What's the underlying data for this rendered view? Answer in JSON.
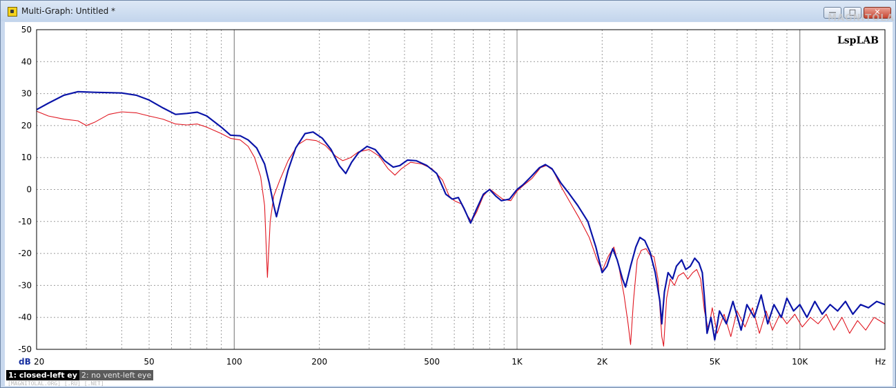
{
  "window": {
    "title": "Multi-Graph: Untitled *",
    "minimize_glyph": "—",
    "maximize_glyph": "□",
    "close_glyph": "✕",
    "watermark": "MAGNITOLA"
  },
  "legend": {
    "items": [
      {
        "label": "1: closed-left ey",
        "active": true
      },
      {
        "label": "2: no vent-left eye",
        "active": false
      }
    ]
  },
  "status_hint": "[MAGNITOLAL.ORG] [.RU] [.NET]",
  "chart_data": {
    "type": "line",
    "brand": "LspLAB",
    "ylabel": "dB",
    "xunit": "Hz",
    "xscale": "log",
    "xlim": [
      20,
      20000
    ],
    "ylim": [
      -50,
      50
    ],
    "grid": true,
    "x_ticks": [
      {
        "v": 20,
        "label": "20"
      },
      {
        "v": 50,
        "label": "50"
      },
      {
        "v": 100,
        "label": "100"
      },
      {
        "v": 200,
        "label": "200"
      },
      {
        "v": 500,
        "label": "500"
      },
      {
        "v": 1000,
        "label": "1K"
      },
      {
        "v": 2000,
        "label": "2K"
      },
      {
        "v": 5000,
        "label": "5K"
      },
      {
        "v": 10000,
        "label": "10K"
      }
    ],
    "y_ticks": [
      50,
      40,
      30,
      20,
      10,
      0,
      -10,
      -20,
      -30,
      -40,
      -50
    ],
    "colors": {
      "series1": "#0a14a8",
      "series2": "#e0141e"
    },
    "series": [
      {
        "name": "closed-left ey",
        "color": "#0a14a8",
        "points": [
          [
            20,
            25
          ],
          [
            22,
            27
          ],
          [
            25,
            29.5
          ],
          [
            28,
            30.6
          ],
          [
            32,
            30.4
          ],
          [
            36,
            30.3
          ],
          [
            40,
            30.2
          ],
          [
            45,
            29.5
          ],
          [
            50,
            28
          ],
          [
            56,
            25.5
          ],
          [
            62,
            23.5
          ],
          [
            68,
            23.8
          ],
          [
            74,
            24.2
          ],
          [
            80,
            23
          ],
          [
            90,
            19.5
          ],
          [
            97,
            17
          ],
          [
            105,
            16.8
          ],
          [
            112,
            15.5
          ],
          [
            120,
            13
          ],
          [
            128,
            8
          ],
          [
            133,
            2
          ],
          [
            138,
            -5
          ],
          [
            141,
            -8.5
          ],
          [
            146,
            -3
          ],
          [
            155,
            6
          ],
          [
            165,
            13
          ],
          [
            178,
            17.5
          ],
          [
            190,
            18
          ],
          [
            205,
            16
          ],
          [
            220,
            12.5
          ],
          [
            235,
            7.5
          ],
          [
            248,
            5
          ],
          [
            260,
            8.5
          ],
          [
            275,
            11.5
          ],
          [
            295,
            13.5
          ],
          [
            315,
            12.5
          ],
          [
            340,
            9
          ],
          [
            365,
            7
          ],
          [
            385,
            7.5
          ],
          [
            410,
            9.2
          ],
          [
            440,
            9
          ],
          [
            480,
            7.5
          ],
          [
            520,
            5
          ],
          [
            560,
            -1.5
          ],
          [
            590,
            -3
          ],
          [
            620,
            -2.5
          ],
          [
            650,
            -6
          ],
          [
            685,
            -10.5
          ],
          [
            720,
            -6
          ],
          [
            760,
            -1.5
          ],
          [
            800,
            0
          ],
          [
            840,
            -2
          ],
          [
            880,
            -3.5
          ],
          [
            940,
            -3
          ],
          [
            1000,
            0
          ],
          [
            1050,
            1.5
          ],
          [
            1120,
            4
          ],
          [
            1200,
            6.8
          ],
          [
            1260,
            7.8
          ],
          [
            1330,
            6.5
          ],
          [
            1430,
            2
          ],
          [
            1520,
            -1
          ],
          [
            1640,
            -5
          ],
          [
            1780,
            -10
          ],
          [
            1900,
            -18
          ],
          [
            2000,
            -26
          ],
          [
            2080,
            -24
          ],
          [
            2180,
            -18.5
          ],
          [
            2260,
            -22
          ],
          [
            2360,
            -28
          ],
          [
            2420,
            -30.5
          ],
          [
            2520,
            -24
          ],
          [
            2630,
            -18
          ],
          [
            2720,
            -15
          ],
          [
            2830,
            -16
          ],
          [
            2950,
            -19.5
          ],
          [
            3080,
            -26
          ],
          [
            3200,
            -35
          ],
          [
            3250,
            -42
          ],
          [
            3320,
            -32
          ],
          [
            3420,
            -26
          ],
          [
            3550,
            -28
          ],
          [
            3660,
            -24
          ],
          [
            3820,
            -22
          ],
          [
            3950,
            -25
          ],
          [
            4100,
            -24
          ],
          [
            4250,
            -21.5
          ],
          [
            4400,
            -23
          ],
          [
            4520,
            -26
          ],
          [
            4600,
            -34
          ],
          [
            4700,
            -45
          ],
          [
            4850,
            -40
          ],
          [
            5000,
            -47
          ],
          [
            5200,
            -38
          ],
          [
            5500,
            -42
          ],
          [
            5800,
            -35
          ],
          [
            6200,
            -44
          ],
          [
            6500,
            -36
          ],
          [
            6900,
            -40
          ],
          [
            7300,
            -33
          ],
          [
            7700,
            -42
          ],
          [
            8100,
            -36
          ],
          [
            8600,
            -40
          ],
          [
            9000,
            -34
          ],
          [
            9500,
            -38
          ],
          [
            10000,
            -36
          ],
          [
            10600,
            -40
          ],
          [
            11300,
            -35
          ],
          [
            12000,
            -39
          ],
          [
            12800,
            -36
          ],
          [
            13600,
            -38
          ],
          [
            14500,
            -35
          ],
          [
            15400,
            -39
          ],
          [
            16400,
            -36
          ],
          [
            17500,
            -37
          ],
          [
            18700,
            -35
          ],
          [
            20000,
            -36
          ]
        ]
      },
      {
        "name": "no vent-left eye",
        "color": "#e0141e",
        "points": [
          [
            20,
            24.5
          ],
          [
            22,
            23
          ],
          [
            25,
            22
          ],
          [
            28,
            21.5
          ],
          [
            30,
            20
          ],
          [
            32,
            21
          ],
          [
            36,
            23.5
          ],
          [
            40,
            24.3
          ],
          [
            45,
            24
          ],
          [
            50,
            23
          ],
          [
            56,
            22
          ],
          [
            62,
            20.5
          ],
          [
            68,
            20.2
          ],
          [
            74,
            20.5
          ],
          [
            80,
            19.5
          ],
          [
            90,
            17.5
          ],
          [
            97,
            16
          ],
          [
            105,
            15.5
          ],
          [
            112,
            13.5
          ],
          [
            118,
            10
          ],
          [
            124,
            4
          ],
          [
            128,
            -5
          ],
          [
            131,
            -27.5
          ],
          [
            134,
            -10
          ],
          [
            138,
            -2
          ],
          [
            145,
            3
          ],
          [
            155,
            9
          ],
          [
            168,
            14
          ],
          [
            180,
            15.7
          ],
          [
            195,
            15.3
          ],
          [
            210,
            13.8
          ],
          [
            228,
            10.5
          ],
          [
            242,
            9
          ],
          [
            258,
            10
          ],
          [
            275,
            11.8
          ],
          [
            300,
            12.5
          ],
          [
            325,
            10.5
          ],
          [
            350,
            6.5
          ],
          [
            370,
            4.5
          ],
          [
            390,
            6.5
          ],
          [
            420,
            8.5
          ],
          [
            460,
            8
          ],
          [
            500,
            6.5
          ],
          [
            545,
            3
          ],
          [
            575,
            -2
          ],
          [
            600,
            -3.5
          ],
          [
            635,
            -4.5
          ],
          [
            660,
            -7.5
          ],
          [
            690,
            -10
          ],
          [
            720,
            -7
          ],
          [
            760,
            -2
          ],
          [
            800,
            0.2
          ],
          [
            845,
            -1.5
          ],
          [
            890,
            -3
          ],
          [
            950,
            -3.5
          ],
          [
            1000,
            -0.5
          ],
          [
            1060,
            1.5
          ],
          [
            1130,
            3.5
          ],
          [
            1210,
            6.8
          ],
          [
            1270,
            7.5
          ],
          [
            1340,
            6
          ],
          [
            1440,
            0.5
          ],
          [
            1540,
            -4
          ],
          [
            1660,
            -9
          ],
          [
            1800,
            -15
          ],
          [
            1920,
            -22
          ],
          [
            2000,
            -25.5
          ],
          [
            2100,
            -21
          ],
          [
            2200,
            -18
          ],
          [
            2290,
            -24
          ],
          [
            2390,
            -33
          ],
          [
            2470,
            -42
          ],
          [
            2520,
            -48.5
          ],
          [
            2580,
            -35
          ],
          [
            2660,
            -22
          ],
          [
            2750,
            -19
          ],
          [
            2860,
            -18.5
          ],
          [
            2950,
            -20.5
          ],
          [
            3050,
            -21
          ],
          [
            3150,
            -28
          ],
          [
            3250,
            -46
          ],
          [
            3300,
            -49
          ],
          [
            3380,
            -34
          ],
          [
            3480,
            -28
          ],
          [
            3600,
            -30
          ],
          [
            3720,
            -27
          ],
          [
            3880,
            -26
          ],
          [
            4020,
            -28
          ],
          [
            4180,
            -26
          ],
          [
            4320,
            -25
          ],
          [
            4460,
            -28
          ],
          [
            4600,
            -38
          ],
          [
            4750,
            -44
          ],
          [
            4900,
            -37
          ],
          [
            5100,
            -45
          ],
          [
            5400,
            -39
          ],
          [
            5700,
            -46
          ],
          [
            6000,
            -38
          ],
          [
            6400,
            -43
          ],
          [
            6800,
            -37
          ],
          [
            7200,
            -45
          ],
          [
            7600,
            -38
          ],
          [
            8000,
            -44
          ],
          [
            8500,
            -39
          ],
          [
            9000,
            -42
          ],
          [
            9600,
            -39
          ],
          [
            10200,
            -43
          ],
          [
            10900,
            -40
          ],
          [
            11600,
            -42
          ],
          [
            12400,
            -39
          ],
          [
            13200,
            -44
          ],
          [
            14100,
            -40
          ],
          [
            15000,
            -45
          ],
          [
            16000,
            -41
          ],
          [
            17100,
            -44
          ],
          [
            18300,
            -40
          ],
          [
            20000,
            -42
          ]
        ]
      }
    ]
  }
}
